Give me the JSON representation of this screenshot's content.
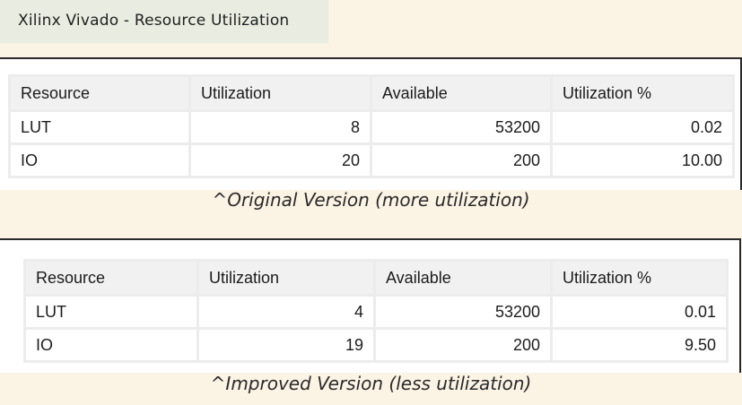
{
  "header": {
    "title": "Xilinx Vivado - Resource Utilization"
  },
  "tables": [
    {
      "columns": [
        "Resource",
        "Utilization",
        "Available",
        "Utilization %"
      ],
      "rows": [
        [
          "LUT",
          "8",
          "53200",
          "0.02"
        ],
        [
          "IO",
          "20",
          "200",
          "10.00"
        ]
      ],
      "caption": "^Original Version (more utilization)"
    },
    {
      "columns": [
        "Resource",
        "Utilization",
        "Available",
        "Utilization %"
      ],
      "rows": [
        [
          "LUT",
          "4",
          "53200",
          "0.01"
        ],
        [
          "IO",
          "19",
          "200",
          "9.50"
        ]
      ],
      "caption": "^Improved Version (less utilization)"
    }
  ]
}
